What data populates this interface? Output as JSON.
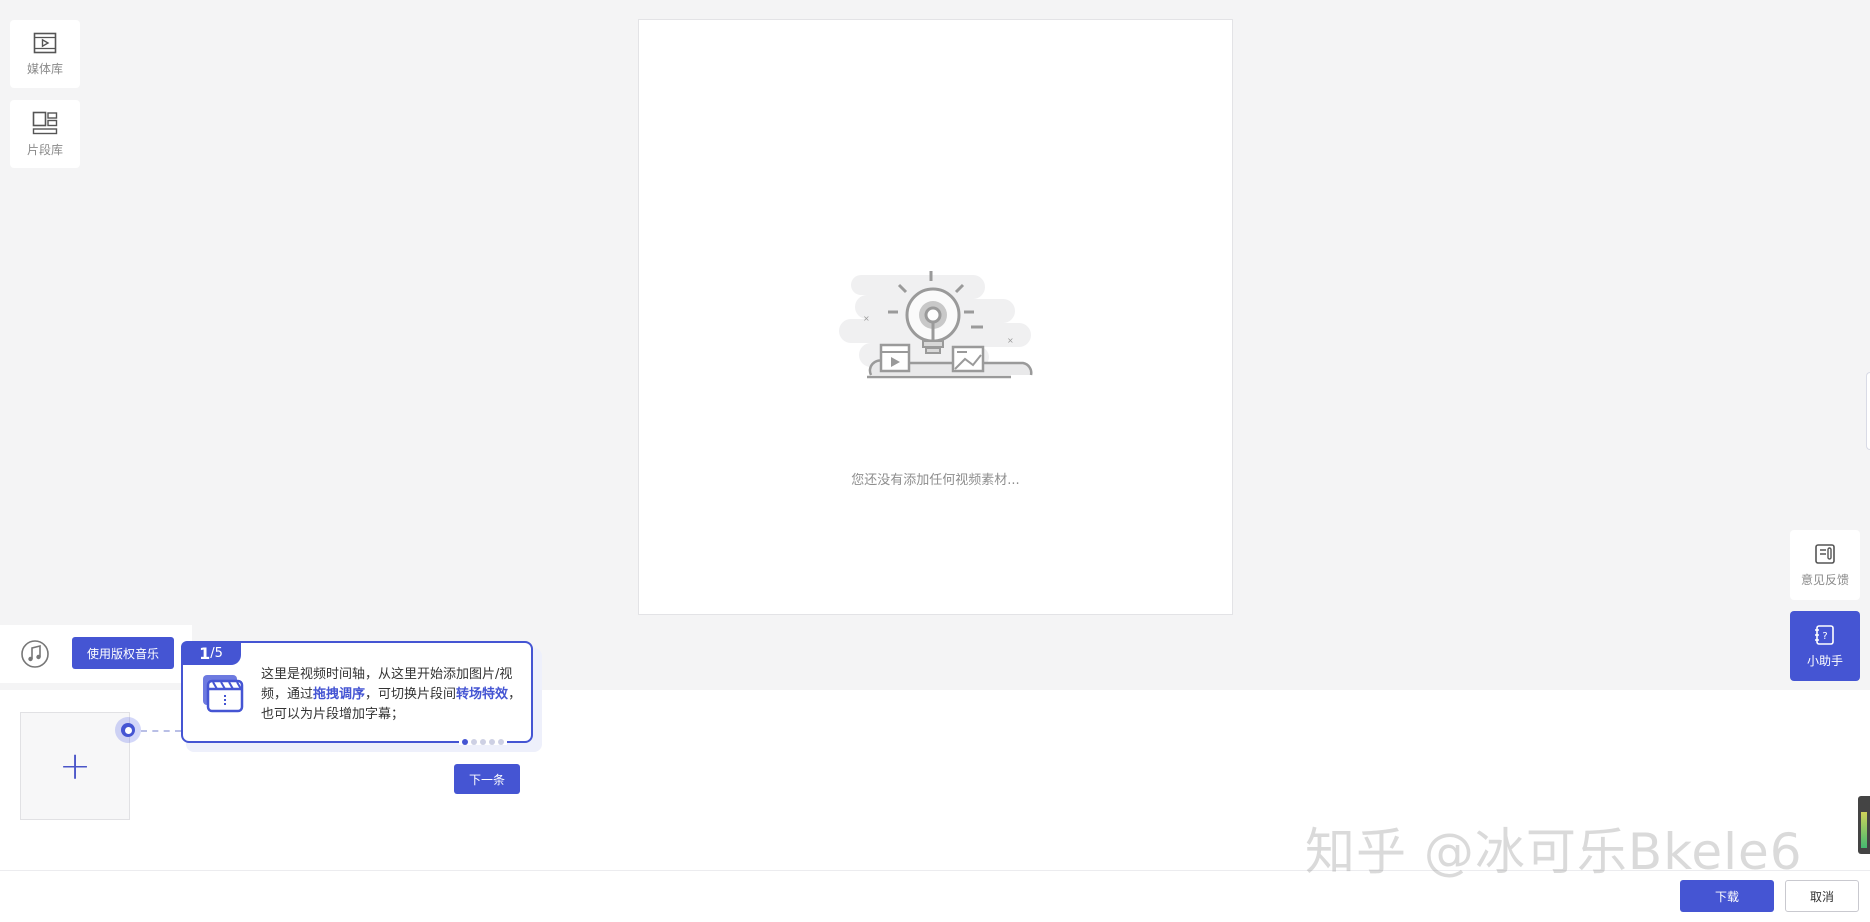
{
  "sidebar": {
    "items": [
      {
        "label": "媒体库",
        "icon": "media-library-icon"
      },
      {
        "label": "片段库",
        "icon": "clip-library-icon"
      }
    ]
  },
  "preview": {
    "empty_message": "您还没有添加任何视频素材..."
  },
  "right_panel": {
    "feedback_label": "意见反馈",
    "assistant_label": "小助手"
  },
  "music": {
    "button_label": "使用版权音乐"
  },
  "guide": {
    "step_current": "1",
    "step_total": "/5",
    "text_part1": "这里是视频时间轴，从这里开始添加图片/视频，通过",
    "highlight1": "拖拽调序",
    "text_part2": "，可切换片段间",
    "highlight2": "转场特效",
    "text_part3": "，也可以为片段增加字幕；",
    "next_label": "下一条",
    "dots_total": 5,
    "dots_active": 1
  },
  "footer": {
    "download_label": "下载",
    "cancel_label": "取消"
  },
  "watermark": "知乎 @冰可乐Bkele6",
  "colors": {
    "accent": "#4555d3",
    "background": "#f4f4f5",
    "panel": "#ffffff"
  }
}
